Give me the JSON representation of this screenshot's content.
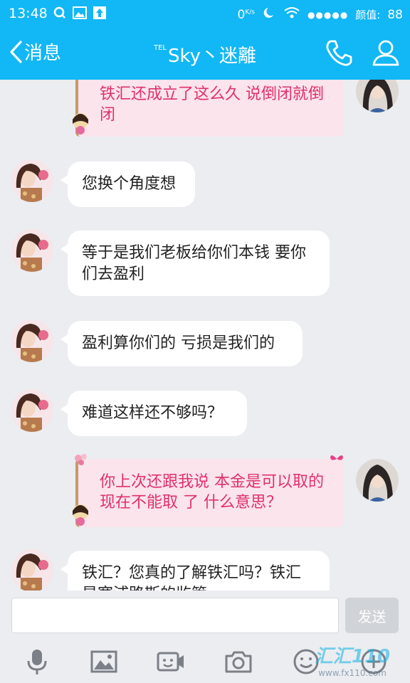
{
  "status": {
    "time": "13:48",
    "net_speed": "0",
    "net_unit": "K/s",
    "signal_dots": "●●●●●",
    "carrier": "颜值:",
    "battery": "88"
  },
  "nav": {
    "back_label": "消息",
    "title_prefix": "TEL",
    "title": "Sky丶迷離"
  },
  "messages": [
    {
      "side": "out",
      "text": "铁汇还成立了这么久  说倒闭就倒闭"
    },
    {
      "side": "in",
      "text": "您换个角度想"
    },
    {
      "side": "in",
      "text": "等于是我们老板给你们本钱 要你们去盈利"
    },
    {
      "side": "in",
      "text": "盈利算你们的 亏损是我们的"
    },
    {
      "side": "in",
      "text": "难道这样还不够吗？"
    },
    {
      "side": "out",
      "text": "你上次还跟我说 本金是可以取的 现在不能取 了 什么意思？"
    },
    {
      "side": "in",
      "text": "铁汇？您真的了解铁汇吗？铁汇是塞浦路斯的监管"
    }
  ],
  "input": {
    "placeholder": "",
    "send_label": "发送"
  },
  "toolbar": {
    "icons": [
      "microphone-icon",
      "image-icon",
      "video-icon",
      "camera-icon",
      "emoji-icon",
      "plus-icon"
    ]
  },
  "watermark": {
    "text": "汇汇110",
    "url": "www.fx110.com"
  },
  "colors": {
    "accent": "#12b7f5",
    "outgoing_text": "#e0306a",
    "outgoing_bg": "#fce4ec"
  }
}
